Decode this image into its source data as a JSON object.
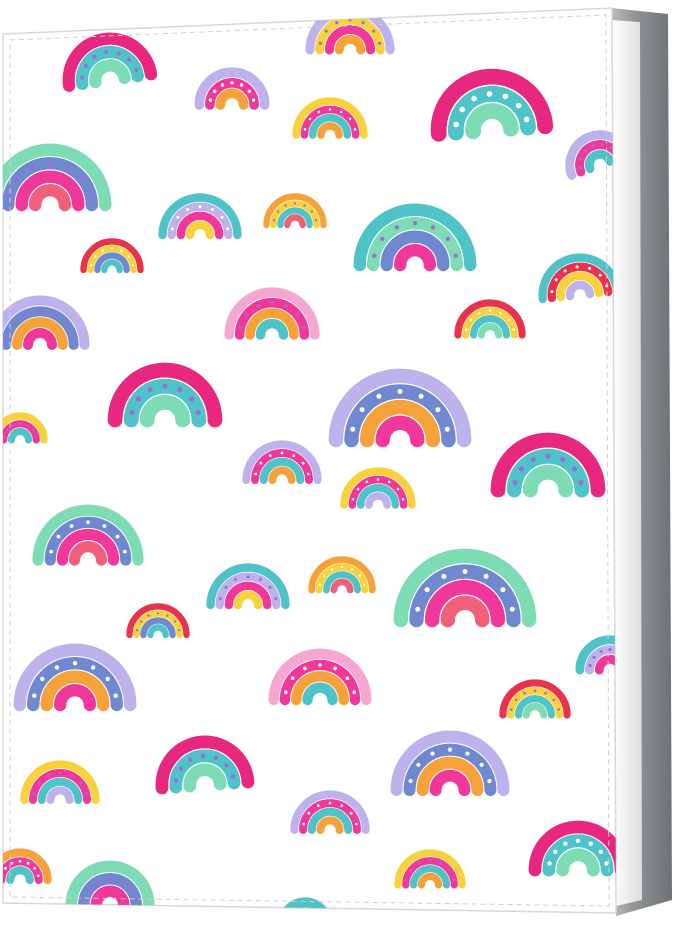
{
  "product": {
    "colors": {
      "background": "#ffffff",
      "cover": "#ffffff",
      "spine": "#8f9294",
      "spine_shadow": "#6f7275",
      "pages": "#f4f4f2",
      "stitch": "#cfcfcf",
      "edge": "#d8d8d8"
    },
    "palette": {
      "pink": "#f0389a",
      "hotpink": "#e8287f",
      "teal": "#4fc3c8",
      "mint": "#7edcb4",
      "lavender": "#bdb2ec",
      "periwinkle": "#6f88d0",
      "yellow": "#f7d23a",
      "orange": "#f5a23a",
      "coral": "#f0607a",
      "lightpink": "#f6a7cf",
      "purple": "#9b6fd6",
      "red": "#e8334f",
      "white": "#ffffff"
    },
    "pattern_icon": "rainbow-icon"
  }
}
